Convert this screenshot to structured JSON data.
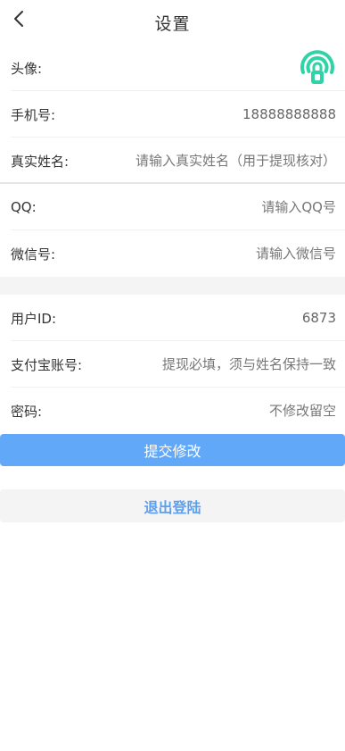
{
  "header": {
    "title": "设置",
    "back_icon": "chevron-left-icon"
  },
  "profile": {
    "avatar_label": "头像:",
    "avatar_icon": "podcast-lock-icon",
    "avatar_color": "#2fd3a6",
    "phone_label": "手机号:",
    "phone_value": "18888888888",
    "realname_label": "真实姓名:",
    "realname_placeholder": "请输入真实姓名（用于提现核对）",
    "qq_label": "QQ:",
    "qq_placeholder": "请输入QQ号",
    "wechat_label": "微信号:",
    "wechat_placeholder": "请输入微信号"
  },
  "account": {
    "userid_label": "用户ID:",
    "userid_value": "6873",
    "alipay_label": "支付宝账号:",
    "alipay_placeholder": "提现必填，须与姓名保持一致",
    "password_label": "密码:",
    "password_placeholder": "不修改留空"
  },
  "actions": {
    "submit_label": "提交修改",
    "submit_color": "#62a8f8",
    "logout_label": "退出登陆",
    "logout_color": "#5c9ff0"
  }
}
